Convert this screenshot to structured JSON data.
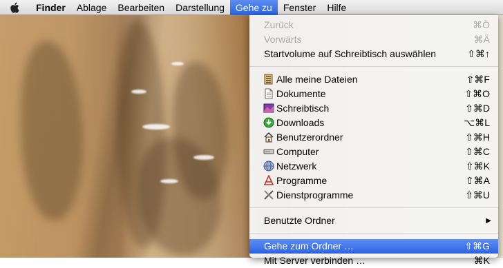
{
  "menubar": {
    "apple_icon": "apple-logo-icon",
    "items": [
      "Finder",
      "Ablage",
      "Bearbeiten",
      "Darstellung",
      "Gehe zu",
      "Fenster",
      "Hilfe"
    ],
    "active_item": "Gehe zu"
  },
  "menu": {
    "section1": [
      {
        "label": "Zurück",
        "shortcut": "⌘Ö",
        "enabled": false
      },
      {
        "label": "Vorwärts",
        "shortcut": "⌘Ä",
        "enabled": false
      },
      {
        "label": "Startvolume auf Schreibtisch auswählen",
        "shortcut": "⇧⌘↑",
        "enabled": true
      }
    ],
    "section2": [
      {
        "label": "Alle meine Dateien",
        "shortcut": "⇧⌘F",
        "icon": "all-files-icon"
      },
      {
        "label": "Dokumente",
        "shortcut": "⇧⌘O",
        "icon": "document-icon"
      },
      {
        "label": "Schreibtisch",
        "shortcut": "⇧⌘D",
        "icon": "desktop-icon"
      },
      {
        "label": "Downloads",
        "shortcut": "⌥⌘L",
        "icon": "downloads-icon"
      },
      {
        "label": "Benutzerordner",
        "shortcut": "⇧⌘H",
        "icon": "home-icon"
      },
      {
        "label": "Computer",
        "shortcut": "⇧⌘C",
        "icon": "computer-icon"
      },
      {
        "label": "Netzwerk",
        "shortcut": "⇧⌘K",
        "icon": "network-icon"
      },
      {
        "label": "Programme",
        "shortcut": "⇧⌘A",
        "icon": "applications-icon"
      },
      {
        "label": "Dienstprogramme",
        "shortcut": "⇧⌘U",
        "icon": "utilities-icon"
      }
    ],
    "section3": [
      {
        "label": "Benutzte Ordner",
        "submenu": "▶"
      }
    ],
    "section4": [
      {
        "label": "Gehe zum Ordner …",
        "shortcut": "⇧⌘G",
        "selected": true
      },
      {
        "label": "Mit Server verbinden …",
        "shortcut": "⌘K"
      }
    ]
  },
  "colors": {
    "highlight": "#2b62e1",
    "disabled_text": "#a8a8a8",
    "menu_bg": "#f5f5f5"
  }
}
